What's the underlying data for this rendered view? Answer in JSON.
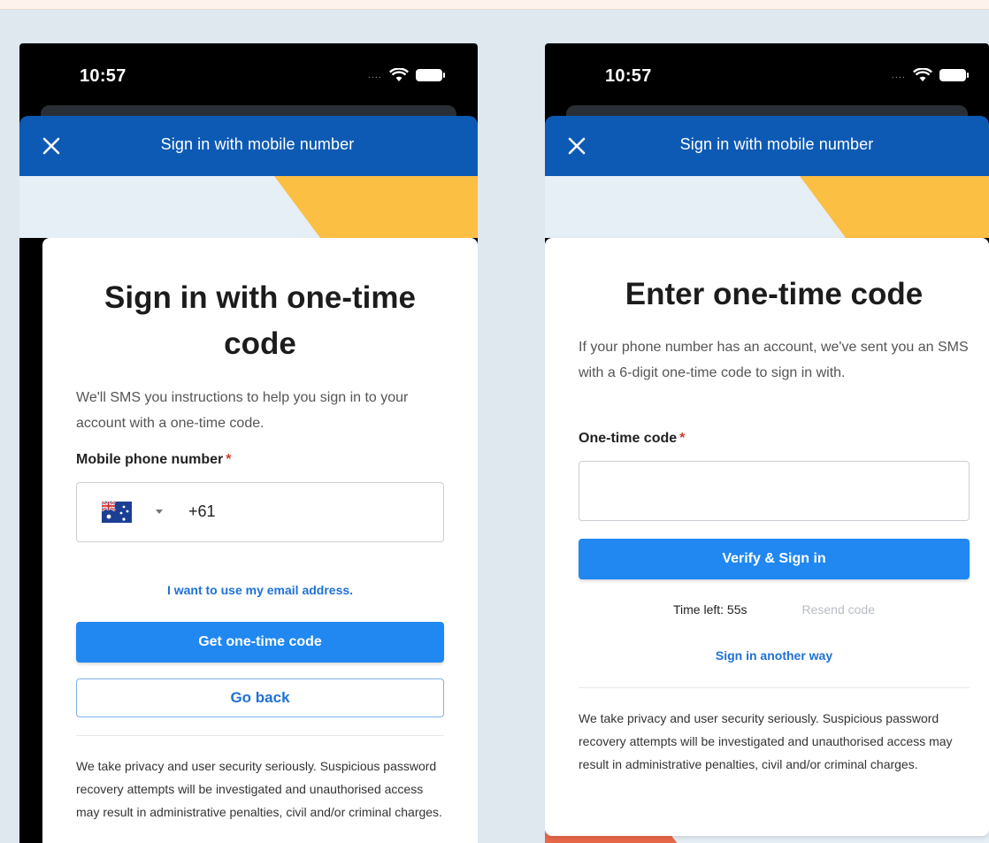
{
  "left_screen": {
    "status_time": "10:57",
    "app_bar_title": "Sign in with mobile number",
    "heading": "Sign in with one-time code",
    "description": "We'll SMS you instructions to help you sign in to your account with a one-time code.",
    "phone_label": "Mobile phone number",
    "required_mark": "*",
    "dial_code": "+61",
    "email_link": "I want to use my email address.",
    "primary_button": "Get one-time code",
    "secondary_button": "Go back",
    "privacy_text": "We take privacy and user security seriously. Suspicious password recovery attempts will be investigated and unauthorised access may result in administrative penalties, civil and/or criminal charges."
  },
  "right_screen": {
    "status_time": "10:57",
    "app_bar_title": "Sign in with mobile number",
    "heading": "Enter one-time code",
    "description": "If your phone number has an account, we've sent you an SMS with a 6-digit one-time code to sign in with.",
    "code_label": "One-time code",
    "required_mark": "*",
    "code_value": "",
    "primary_button": "Verify & Sign in",
    "timer_text": "Time left: 55s",
    "resend_link": "Resend code",
    "other_way_link": "Sign in another way",
    "privacy_text": "We take privacy and user security seriously. Suspicious password recovery attempts will be investigated and unauthorised access may result in administrative penalties, civil and/or criminal charges."
  },
  "colors": {
    "app_bar": "#0d5ab4",
    "primary_button": "#2088f0",
    "accent_yellow": "#fbbf44",
    "accent_orange": "#e8684a",
    "required": "#d63b2f"
  },
  "icons": {
    "close": "close-icon",
    "wifi": "wifi-icon",
    "battery": "battery-icon",
    "flag": "australia-flag-icon",
    "dropdown": "chevron-down-icon"
  }
}
